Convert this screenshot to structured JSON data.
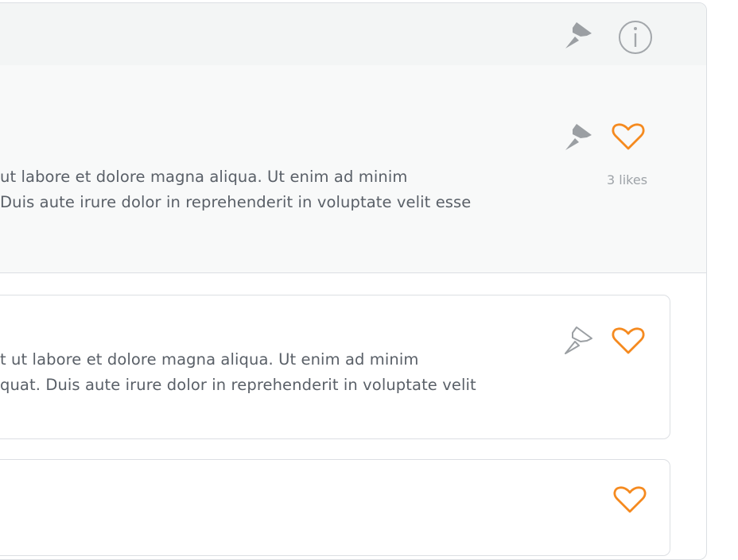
{
  "header": {
    "pin_icon": "pin-filled-icon",
    "info_icon": "info-circle-icon"
  },
  "pinned_comment": {
    "line1": "ut labore et dolore magna aliqua. Ut enim ad minim",
    "line2": "Duis aute irure dolor in reprehenderit in voluptate velit esse",
    "likes_text": "3 likes",
    "pin_icon": "pin-filled-icon",
    "like_icon": "heart-outline-icon"
  },
  "comments": [
    {
      "line1": "t ut labore et dolore magna aliqua. Ut enim ad minim",
      "line2": "quat. Duis aute irure dolor in reprehenderit in voluptate velit",
      "pin_icon": "pin-outline-icon",
      "like_icon": "heart-outline-icon"
    },
    {
      "like_icon": "heart-outline-icon"
    }
  ],
  "colors": {
    "accent": "#f58a1f",
    "pin_gray": "#9b9fa3",
    "text": "#5a6068",
    "muted": "#9ea3a8",
    "border": "#dcdfe3"
  }
}
